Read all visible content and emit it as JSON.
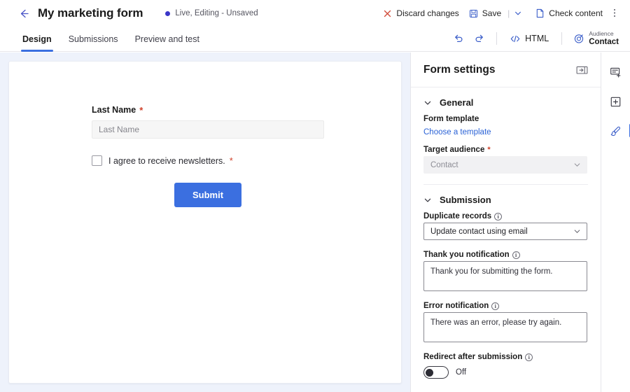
{
  "topbar": {
    "back_icon": "arrow-left-icon",
    "title": "My marketing form",
    "status_text": "Live, Editing - Unsaved",
    "status_dot_color": "#3a36c8",
    "discard_label": "Discard changes",
    "discard_icon": "close-x-icon",
    "save_label": "Save",
    "save_icon": "floppy-disk-icon",
    "save_caret_icon": "chevron-down-icon",
    "separator": "|",
    "check_content_label": "Check content",
    "check_content_icon": "document-icon",
    "overflow_icon": "more-vertical-icon"
  },
  "tabbar": {
    "tabs": [
      {
        "label": "Design",
        "active": true
      },
      {
        "label": "Submissions",
        "active": false
      },
      {
        "label": "Preview and test",
        "active": false
      }
    ],
    "undo_icon": "undo-arrow-icon",
    "redo_icon": "redo-arrow-icon",
    "html_label": "HTML",
    "html_icon": "code-brackets-icon",
    "audience_icon": "target-bullseye-icon",
    "audience_label": "Audience",
    "audience_value": "Contact"
  },
  "canvas": {
    "background_color": "#eef2fb",
    "fields": {
      "last_name_label": "Last Name",
      "last_name_required": "*",
      "last_name_placeholder": "Last Name",
      "last_name_value": "",
      "consent_label": "I agree to receive newsletters.",
      "consent_required": "*",
      "consent_checked": false,
      "submit_label": "Submit",
      "submit_color": "#3b6fe0"
    }
  },
  "settings": {
    "panel_title": "Form settings",
    "collapse_icon": "collapse-panel-right-icon",
    "sections": {
      "general": {
        "title": "General",
        "expanded": true,
        "chevron_icon": "chevron-down-icon",
        "form_template_label": "Form template",
        "choose_template_link": "Choose a template",
        "target_audience_label": "Target audience",
        "target_audience_required": "*",
        "target_audience_value": "Contact",
        "target_audience_disabled": true
      },
      "submission": {
        "title": "Submission",
        "expanded": true,
        "chevron_icon": "chevron-down-icon",
        "duplicate_records_label": "Duplicate records",
        "duplicate_records_value": "Update contact using email",
        "thank_you_label": "Thank you notification",
        "thank_you_value": "Thank you for submitting the form.",
        "error_label": "Error notification",
        "error_value": "There was an error, please try again.",
        "redirect_label": "Redirect after submission",
        "redirect_state": "Off",
        "redirect_on": false,
        "info_icon": "info-circle-icon"
      }
    }
  },
  "rail": {
    "items": [
      {
        "icon": "add-section-icon",
        "name": "add-section",
        "active": false
      },
      {
        "icon": "add-element-icon",
        "name": "add-element",
        "active": false
      },
      {
        "icon": "styles-brush-icon",
        "name": "styles",
        "active": true
      }
    ]
  }
}
